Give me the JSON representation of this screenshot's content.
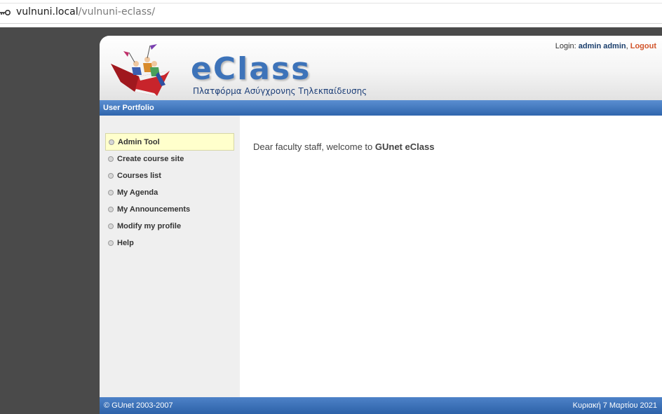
{
  "browser": {
    "url_host": "vulnuni.local",
    "url_path": "/vulnuni-eclass/",
    "site_info_icon": "key-icon"
  },
  "header": {
    "brand": "eClass",
    "subtitle": "Πλατφόρμα Ασύγχρονης Τηλεκπαίδευσης",
    "login_label": "Login:",
    "login_user": "admin admin",
    "separator": ",",
    "logout_label": "Logout",
    "logo_icon": "flying-book-logo"
  },
  "nav": {
    "section_title": "User Portfolio"
  },
  "sidebar": {
    "items": [
      {
        "label": "Admin Tool"
      },
      {
        "label": "Create course site"
      },
      {
        "label": "Courses list"
      },
      {
        "label": "My Agenda"
      },
      {
        "label": "My Announcements"
      },
      {
        "label": "Modify my profile"
      },
      {
        "label": "Help"
      }
    ],
    "bullet_icon": "circle-bullet-icon"
  },
  "main": {
    "welcome_prefix": "Dear faculty staff, welcome to ",
    "welcome_brand": "GUnet eClass"
  },
  "footer": {
    "copyright": "© GUnet 2003-2007",
    "date": "Κυριακή 7 Μαρτίου 2021"
  },
  "colors": {
    "accent_blue": "#3d73b9",
    "bar_blue": "#2f65ad",
    "logout_orange": "#d2542a",
    "active_item_bg": "#ffffcc"
  }
}
